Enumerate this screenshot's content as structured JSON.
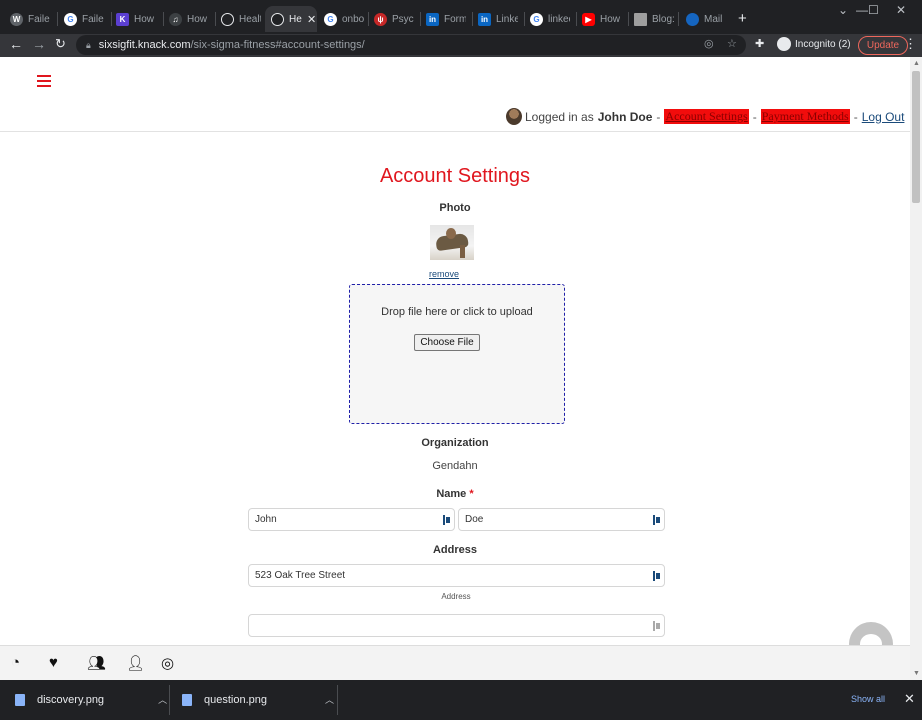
{
  "browser": {
    "tabs": [
      {
        "label": "Failed",
        "icon": "wordpress-icon",
        "color": "#5f6368"
      },
      {
        "label": "Failed",
        "icon": "google-icon",
        "color": "#ffffff"
      },
      {
        "label": "How t",
        "icon": "knack-k-icon",
        "color": "#5b3fd1"
      },
      {
        "label": "How T",
        "icon": "podcast-icon",
        "color": "#202124"
      },
      {
        "label": "Health",
        "icon": "loom-icon",
        "color": "#202124"
      },
      {
        "label": "He",
        "icon": "loom-icon",
        "color": "#202124",
        "active": true
      },
      {
        "label": "onboa",
        "icon": "google-icon",
        "color": "#ffffff"
      },
      {
        "label": "Psych",
        "icon": "psychology-icon",
        "color": "#c62828"
      },
      {
        "label": "Forms",
        "icon": "linkedin-icon",
        "color": "#0a66c2"
      },
      {
        "label": "Linked",
        "icon": "linkedin-icon",
        "color": "#0a66c2"
      },
      {
        "label": "linked",
        "icon": "google-icon",
        "color": "#ffffff"
      },
      {
        "label": "How t",
        "icon": "youtube-icon",
        "color": "#ff0000"
      },
      {
        "label": "Blog:",
        "icon": "blog-icon",
        "color": "#9e9e9e"
      },
      {
        "label": "Mail |",
        "icon": "mail-icon",
        "color": "#1565c0"
      }
    ],
    "url_host": "sixsigfit.knack.com",
    "url_path": "/six-sigma-fitness#account-settings/",
    "incognito_label": "Incognito (2)",
    "update_label": "Update"
  },
  "userbar": {
    "logged_in_as": "Logged in as",
    "user_name": "John Doe",
    "account_settings": "Account Settings",
    "payment_methods": "Payment Methods",
    "logout": "Log Out",
    "separator": "-"
  },
  "page": {
    "title": "Account Settings",
    "photo_label": "Photo",
    "remove_label": "remove",
    "dropzone_text": "Drop file here or click to upload",
    "choose_file_label": "Choose File",
    "organization_label": "Organization",
    "organization_value": "Gendahn",
    "name_label": "Name",
    "name_required": "*",
    "first_name": "John",
    "last_name": "Doe",
    "address_label": "Address",
    "address_line1": "523 Oak Tree Street",
    "address_sublabel": "Address",
    "address_line2": ""
  },
  "downloads": {
    "items": [
      "discovery.png",
      "question.png"
    ],
    "show_all": "Show all"
  },
  "colors": {
    "brand_red": "#e0161e",
    "highlight_red": "#f20c0c",
    "link_blue": "#1a4a7a"
  }
}
